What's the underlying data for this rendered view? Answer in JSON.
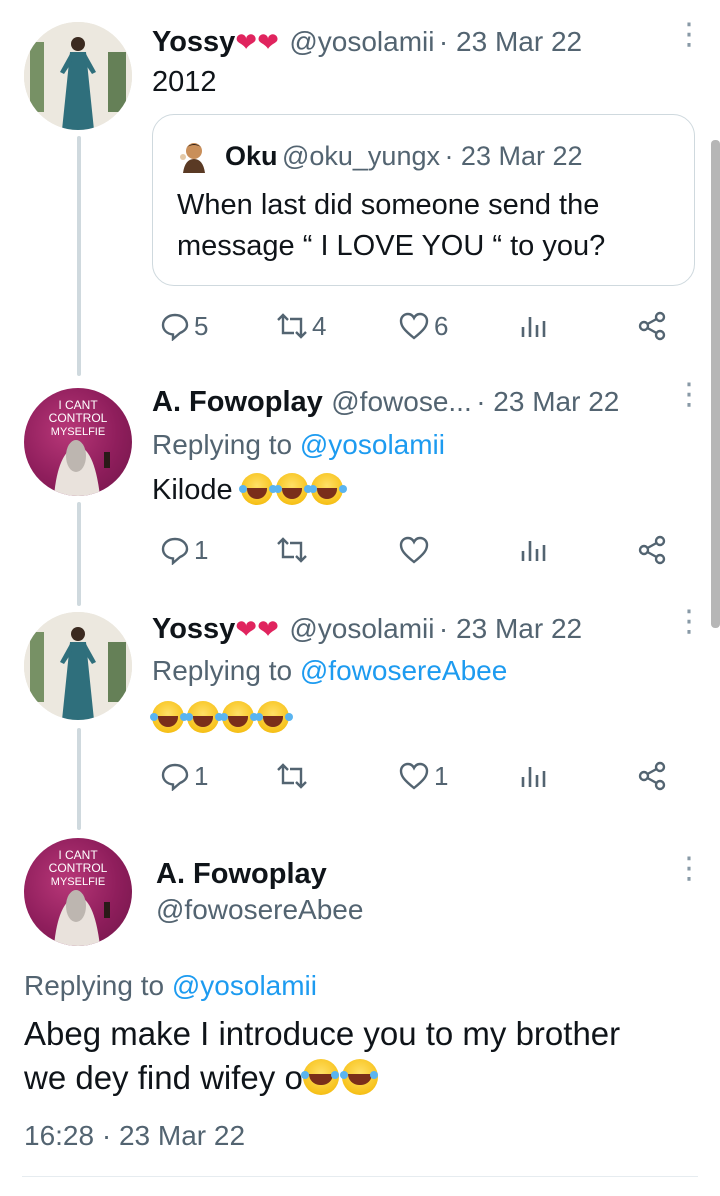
{
  "tweets": [
    {
      "name": "Yossy",
      "hearts": "❤❤",
      "handle": "@yosolamii",
      "dot_date": "· 23 Mar 22",
      "text": "2012",
      "quote": {
        "name": "Oku",
        "handle": "@oku_yungx",
        "date": "· 23 Mar 22",
        "line1": "When last did someone send the",
        "line2": "message “ I LOVE YOU “ to you?"
      },
      "stats": {
        "replies": "5",
        "retweets": "4",
        "likes": "6"
      }
    },
    {
      "name": "A. Fowoplay",
      "handle": "@fowose...",
      "dot_date": "· 23 Mar 22",
      "replying_prefix": "Replying to ",
      "replying_handle": "@yosolamii",
      "text": "Kilode",
      "stats": {
        "replies": "1",
        "retweets": "",
        "likes": ""
      }
    },
    {
      "name": "Yossy",
      "hearts": "❤❤",
      "handle": "@yosolamii",
      "dot_date": "· 23 Mar 22",
      "replying_prefix": "Replying to ",
      "replying_handle": "@fowosereAbee",
      "stats": {
        "replies": "1",
        "retweets": "",
        "likes": "1"
      }
    },
    {
      "name": "A. Fowoplay",
      "handle": "@fowosereAbee",
      "replying_prefix": "Replying to ",
      "replying_handle": "@yosolamii",
      "line1": "Abeg make I introduce you to my brother",
      "line2": "we dey find wifey o",
      "timestamp": "16:28 · 23 Mar 22"
    }
  ],
  "avatar_text": {
    "line1": "I CANT",
    "line2": "CONTROL",
    "line3": "MYSELFIE"
  },
  "colors": {
    "link": "#1d9bf0",
    "meta": "#536471",
    "heart": "#e0245e"
  },
  "icons": [
    "reply-icon",
    "retweet-icon",
    "like-icon",
    "views-icon",
    "share-icon",
    "more-icon"
  ]
}
